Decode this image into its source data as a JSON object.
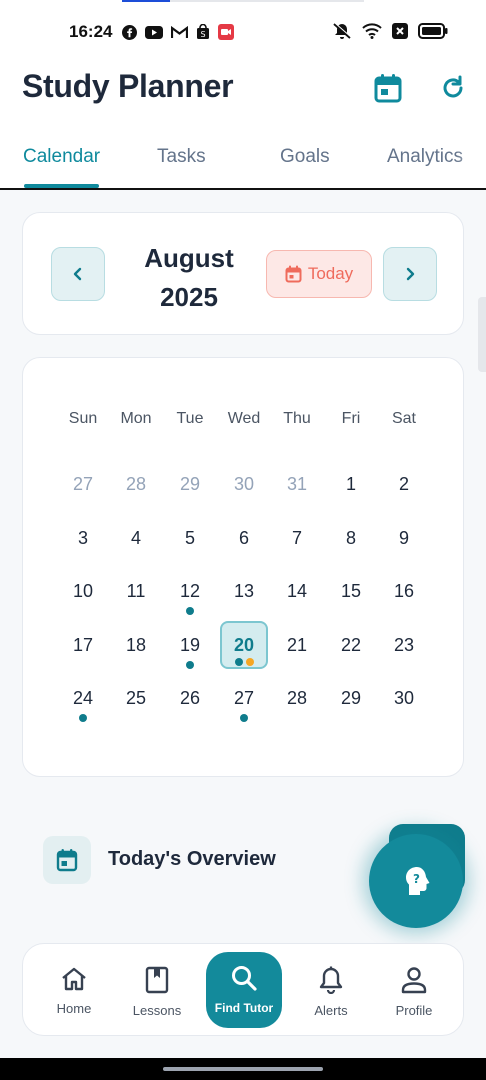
{
  "status": {
    "time": "16:24",
    "progress_fraction": 0.2,
    "left_icons": [
      "facebook-icon",
      "youtube-icon",
      "gmail-icon",
      "shopping-bag-icon",
      "video-record-icon"
    ],
    "right_icons": [
      "mute-icon",
      "wifi-icon",
      "close-box-icon",
      "battery-icon"
    ]
  },
  "header": {
    "title": "Study Planner",
    "calendar_icon": "calendar-icon",
    "refresh_icon": "refresh-icon"
  },
  "tabs": [
    {
      "label": "Calendar",
      "active": true
    },
    {
      "label": "Tasks",
      "active": false
    },
    {
      "label": "Goals",
      "active": false
    },
    {
      "label": "Analytics",
      "active": false
    }
  ],
  "month_nav": {
    "month": "August",
    "year": "2025",
    "today_label": "Today",
    "prev_icon": "chevron-left-icon",
    "next_icon": "chevron-right-icon"
  },
  "calendar": {
    "weekdays": [
      "Sun",
      "Mon",
      "Tue",
      "Wed",
      "Thu",
      "Fri",
      "Sat"
    ],
    "weeks": [
      [
        {
          "d": "27",
          "muted": true
        },
        {
          "d": "28",
          "muted": true
        },
        {
          "d": "29",
          "muted": true
        },
        {
          "d": "30",
          "muted": true
        },
        {
          "d": "31",
          "muted": true
        },
        {
          "d": "1"
        },
        {
          "d": "2"
        }
      ],
      [
        {
          "d": "3"
        },
        {
          "d": "4"
        },
        {
          "d": "5"
        },
        {
          "d": "6"
        },
        {
          "d": "7"
        },
        {
          "d": "8"
        },
        {
          "d": "9"
        }
      ],
      [
        {
          "d": "10"
        },
        {
          "d": "11"
        },
        {
          "d": "12",
          "dots": [
            "#0f7c8c"
          ]
        },
        {
          "d": "13"
        },
        {
          "d": "14"
        },
        {
          "d": "15"
        },
        {
          "d": "16"
        }
      ],
      [
        {
          "d": "17"
        },
        {
          "d": "18"
        },
        {
          "d": "19",
          "dots": [
            "#0f7c8c"
          ]
        },
        {
          "d": "20",
          "selected": true,
          "dots": [
            "#0f7c8c",
            "#f5a623"
          ]
        },
        {
          "d": "21"
        },
        {
          "d": "22"
        },
        {
          "d": "23"
        }
      ],
      [
        {
          "d": "24",
          "dots": [
            "#0f7c8c"
          ]
        },
        {
          "d": "25"
        },
        {
          "d": "26"
        },
        {
          "d": "27",
          "dots": [
            "#0f7c8c"
          ]
        },
        {
          "d": "28"
        },
        {
          "d": "29"
        },
        {
          "d": "30"
        }
      ]
    ]
  },
  "overview": {
    "title": "Today's Overview",
    "icon": "calendar-icon"
  },
  "fab": {
    "icon": "help-head-icon"
  },
  "bottom_nav": [
    {
      "label": "Home",
      "icon": "home-icon"
    },
    {
      "label": "Lessons",
      "icon": "book-icon"
    },
    {
      "label": "Find Tutor",
      "icon": "search-icon",
      "center": true
    },
    {
      "label": "Alerts",
      "icon": "bell-icon"
    },
    {
      "label": "Profile",
      "icon": "person-icon"
    }
  ],
  "colors": {
    "accent": "#138a9b",
    "today_accent": "#ef6b5c",
    "event_dot_primary": "#0f7c8c",
    "event_dot_secondary": "#f5a623"
  }
}
